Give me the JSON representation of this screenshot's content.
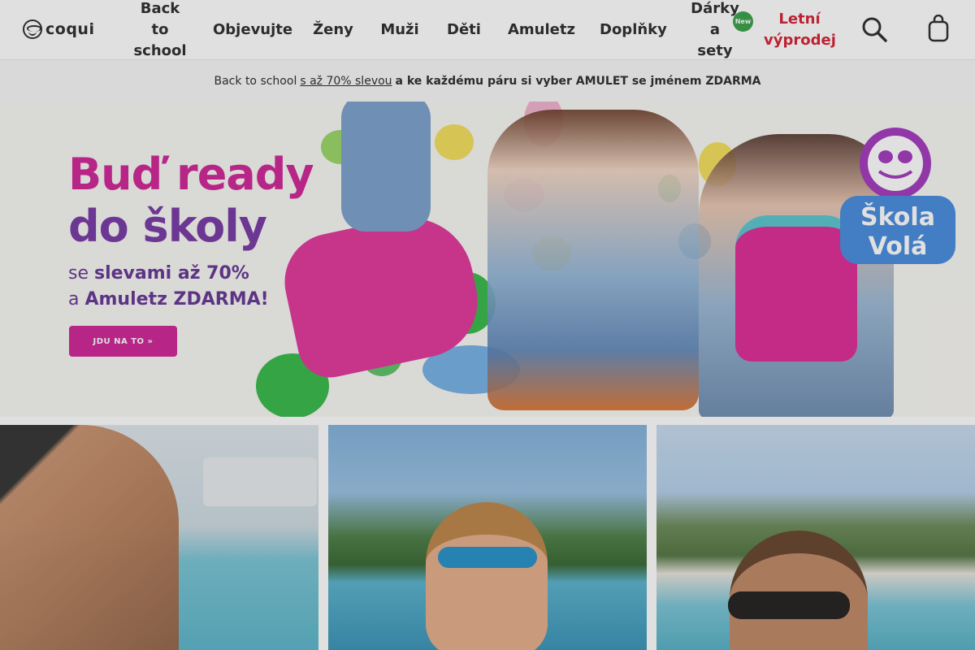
{
  "brand": {
    "logo_text": "coqui",
    "accent": "#d12b9a",
    "sale_color": "#d6283a"
  },
  "nav": {
    "items": [
      {
        "label": "Back\nto\nschool"
      },
      {
        "label": "Objevujte"
      },
      {
        "label": "Ženy"
      },
      {
        "label": "Muži"
      },
      {
        "label": "Děti"
      },
      {
        "label": "Amuletz"
      },
      {
        "label": "Doplňky"
      },
      {
        "label": "Dárky\na\nsety"
      },
      {
        "label": "Letní\nvýprodej"
      }
    ],
    "new_badge": "New",
    "search_icon": "search-icon",
    "cart_icon": "shopping-bag-icon"
  },
  "promo": {
    "icon_left": "",
    "lead": "Back to school",
    "link": "s až 70% slevou",
    "rest": "a ke každému páru si vyber AMULET se jménem ZDARMA",
    "icon_right": ""
  },
  "hero": {
    "title_line1": "Buď ready",
    "title_line2": "do školy",
    "sub_line1_pre": "se ",
    "sub_line1_bold": "slevami až 70%",
    "sub_line2_pre": "a ",
    "sub_line2_bold": "Amuletz ZDARMA!",
    "cta": "JDU NA TO »",
    "badge_line1": "Škola",
    "badge_line2": "Volá"
  },
  "tiles": [
    {
      "name": "women"
    },
    {
      "name": "kids"
    },
    {
      "name": "men"
    }
  ]
}
